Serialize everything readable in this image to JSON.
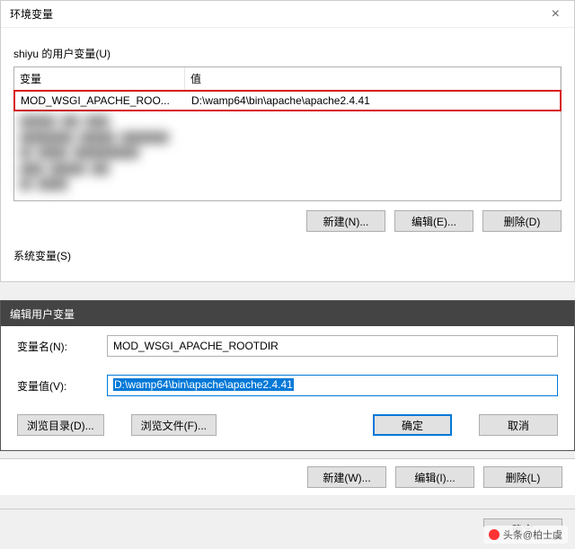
{
  "env_dialog": {
    "title": "环境变量",
    "close_glyph": "×",
    "user_vars_label": "shiyu 的用户变量(U)",
    "columns": {
      "name": "变量",
      "value": "值"
    },
    "highlighted_row": {
      "name": "MOD_WSGI_APACHE_ROO...",
      "value": "D:\\wamp64\\bin\\apache\\apache2.4.41"
    },
    "buttons": {
      "new": "新建(N)...",
      "edit": "编辑(E)...",
      "delete": "删除(D)"
    },
    "system_vars_label": "系统变量(S)"
  },
  "edit_dialog": {
    "title": "编辑用户变量",
    "name_label": "变量名(N):",
    "name_value": "MOD_WSGI_APACHE_ROOTDIR",
    "value_label": "变量值(V):",
    "value_value": "D:\\wamp64\\bin\\apache\\apache2.4.41",
    "browse_dir": "浏览目录(D)...",
    "browse_file": "浏览文件(F)...",
    "ok": "确定",
    "cancel": "取消"
  },
  "sys_buttons": {
    "new": "新建(W)...",
    "edit": "编辑(I)...",
    "delete": "删除(L)"
  },
  "bottom": {
    "ok": "确定"
  },
  "watermark": "头条@柏士虞"
}
